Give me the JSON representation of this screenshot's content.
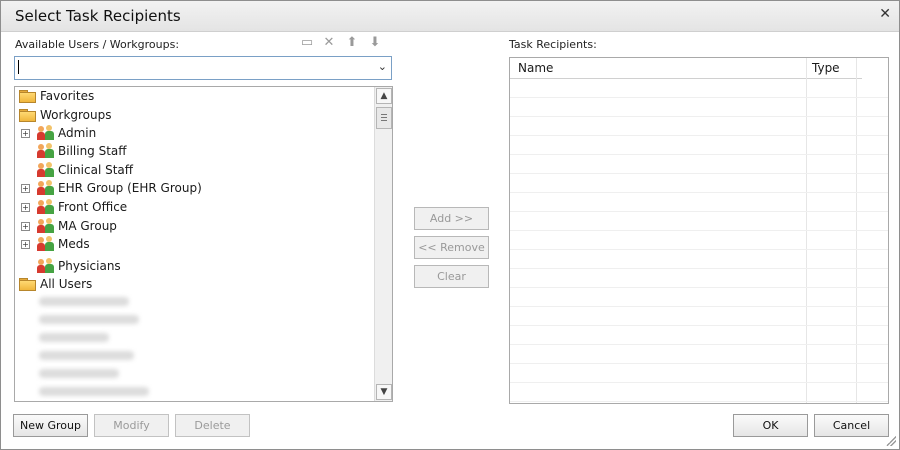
{
  "dialog": {
    "title": "Select Task Recipients"
  },
  "left": {
    "label": "Available Users / Workgroups:",
    "combo_value": "",
    "tree": [
      {
        "label": "Favorites",
        "type": "folder",
        "level": 0,
        "expander": false
      },
      {
        "label": "Workgroups",
        "type": "folder",
        "level": 0,
        "expander": false
      },
      {
        "label": "Admin",
        "type": "group",
        "level": 1,
        "expander": true
      },
      {
        "label": "Billing Staff",
        "type": "group",
        "level": 1,
        "expander": false
      },
      {
        "label": "Clinical Staff",
        "type": "group",
        "level": 1,
        "expander": false
      },
      {
        "label": "EHR Group (EHR Group)",
        "type": "group",
        "level": 1,
        "expander": true
      },
      {
        "label": "Front Office",
        "type": "group",
        "level": 1,
        "expander": true
      },
      {
        "label": "MA Group",
        "type": "group",
        "level": 1,
        "expander": true
      },
      {
        "label": "Meds",
        "type": "group",
        "level": 1,
        "expander": true
      },
      {
        "label": "Physicians",
        "type": "group",
        "level": 1,
        "expander": false
      },
      {
        "label": "All Users",
        "type": "folder",
        "level": 0,
        "expander": false
      }
    ]
  },
  "toolbar_icons": [
    "new-folder-icon",
    "delete-x-icon",
    "move-up-icon",
    "move-down-icon"
  ],
  "middle": {
    "add": "Add >>",
    "remove": "<< Remove",
    "clear": "Clear"
  },
  "right": {
    "label": "Task Recipients:",
    "columns": [
      "Name",
      "Type"
    ]
  },
  "bottom": {
    "new_group": "New Group",
    "modify": "Modify",
    "delete": "Delete",
    "ok": "OK",
    "cancel": "Cancel"
  }
}
